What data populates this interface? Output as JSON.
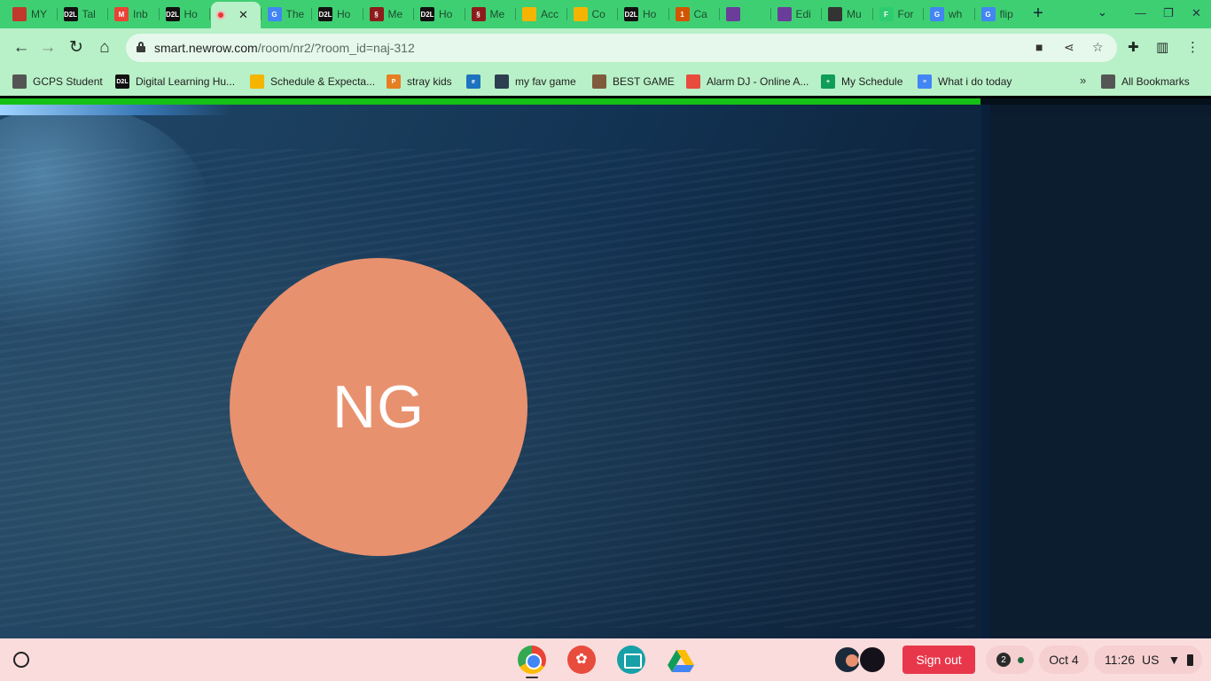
{
  "tabs": [
    {
      "title": "MY",
      "fav": "#c0392b",
      "fav_text": ""
    },
    {
      "title": "Tal",
      "fav": "#111111",
      "fav_text": "D2L"
    },
    {
      "title": "Inb",
      "fav": "#ea4335",
      "fav_text": "M"
    },
    {
      "title": "Ho",
      "fav": "#111111",
      "fav_text": "D2L"
    },
    {
      "title": "",
      "fav": "#e53935",
      "fav_text": "",
      "active": true
    },
    {
      "title": "The",
      "fav": "#4285f4",
      "fav_text": "G"
    },
    {
      "title": "Ho",
      "fav": "#111111",
      "fav_text": "D2L"
    },
    {
      "title": "Me",
      "fav": "#8e1b1b",
      "fav_text": "§"
    },
    {
      "title": "Ho",
      "fav": "#111111",
      "fav_text": "D2L"
    },
    {
      "title": "Me",
      "fav": "#8e1b1b",
      "fav_text": "§"
    },
    {
      "title": "Acc",
      "fav": "#f4b400",
      "fav_text": ""
    },
    {
      "title": "Co",
      "fav": "#f4b400",
      "fav_text": ""
    },
    {
      "title": "Ho",
      "fav": "#111111",
      "fav_text": "D2L"
    },
    {
      "title": "Ca",
      "fav": "#d35400",
      "fav_text": "1"
    },
    {
      "title": "",
      "fav": "#6a3d9a",
      "fav_text": ""
    },
    {
      "title": "Edi",
      "fav": "#6a3d9a",
      "fav_text": ""
    },
    {
      "title": "Mu",
      "fav": "#333333",
      "fav_text": ""
    },
    {
      "title": "For",
      "fav": "#2ecc71",
      "fav_text": "F"
    },
    {
      "title": "wh",
      "fav": "#4285f4",
      "fav_text": "G"
    },
    {
      "title": "flip",
      "fav": "#4285f4",
      "fav_text": "G"
    }
  ],
  "omnibox": {
    "host": "smart.newrow.com",
    "path": "/room/nr2/?room_id=naj-312"
  },
  "bookmarks": [
    {
      "label": "GCPS Student",
      "fav": "#555555",
      "fav_text": ""
    },
    {
      "label": "Digital Learning Hu...",
      "fav": "#111111",
      "fav_text": "D2L"
    },
    {
      "label": "Schedule & Expecta...",
      "fav": "#f4b400",
      "fav_text": ""
    },
    {
      "label": "stray kids",
      "fav": "#e67e22",
      "fav_text": "P"
    },
    {
      "label": "",
      "fav": "#1e73be",
      "fav_text": "e"
    },
    {
      "label": "my fav game",
      "fav": "#2c3e50",
      "fav_text": ""
    },
    {
      "label": "BEST GAME",
      "fav": "#7f5a3c",
      "fav_text": ""
    },
    {
      "label": "Alarm DJ - Online A...",
      "fav": "#e74c3c",
      "fav_text": ""
    },
    {
      "label": "My Schedule",
      "fav": "#0f9d58",
      "fav_text": "+"
    },
    {
      "label": "What i do today",
      "fav": "#4285f4",
      "fav_text": "≡"
    }
  ],
  "bookmarks_all": "All Bookmarks",
  "room": {
    "avatar_initials": "NG",
    "avatar_color": "#e8916f",
    "progress": 0.81
  },
  "shelf": {
    "signout": "Sign out",
    "notification_count": "2",
    "date": "Oct 4",
    "time": "11:26",
    "locale": "US"
  }
}
